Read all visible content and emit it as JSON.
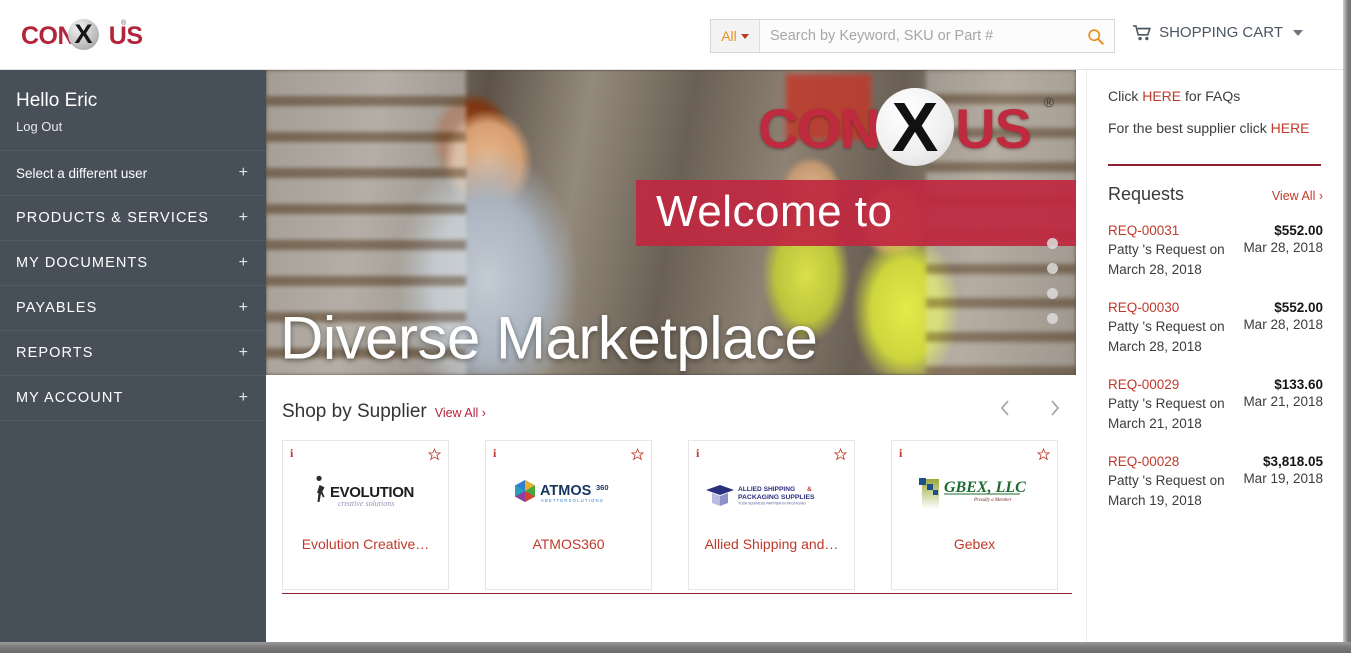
{
  "header": {
    "logo_text_left": "CONN",
    "logo_x": "X",
    "logo_text_right": "US",
    "logo_reg": "®",
    "search": {
      "scope_label": "All",
      "placeholder": "Search by Keyword, SKU or Part #",
      "value": "",
      "search_icon": "search-icon"
    },
    "cart_label": "SHOPPING CART",
    "cart_icon": "shopping-cart-icon"
  },
  "sidebar": {
    "greeting": "Hello Eric",
    "logout": "Log Out",
    "items": [
      {
        "label": "Select a different user",
        "expander": "+",
        "caps": false
      },
      {
        "label": "PRODUCTS & SERVICES",
        "expander": "+",
        "caps": true
      },
      {
        "label": "MY DOCUMENTS",
        "expander": "+",
        "caps": true
      },
      {
        "label": "PAYABLES",
        "expander": "+",
        "caps": true
      },
      {
        "label": "REPORTS",
        "expander": "+",
        "caps": true
      },
      {
        "label": "MY ACCOUNT",
        "expander": "+",
        "caps": true
      }
    ]
  },
  "hero": {
    "brand_left": "CONN",
    "brand_x": "X",
    "brand_right": "US",
    "brand_reg": "®",
    "welcome": "Welcome to",
    "headline": "Diverse Marketplace",
    "dots": 4,
    "band_color": "#c0283f"
  },
  "shop": {
    "title": "Shop by Supplier",
    "view_all": "View All ›",
    "prev_icon": "chevron-left-icon",
    "next_icon": "chevron-right-icon",
    "cards": [
      {
        "name": "Evolution Creative…",
        "logo_label": "EVOLUTION",
        "logo_sub": "creative solutions",
        "info_icon": "info-icon",
        "star_icon": "star-outline-icon"
      },
      {
        "name": "ATMOS360",
        "logo_label": "ATMOS",
        "logo_sub": "360",
        "info_icon": "info-icon",
        "star_icon": "star-outline-icon"
      },
      {
        "name": "Allied Shipping and…",
        "logo_label": "ALLIED SHIPPING &",
        "logo_sub": "PACKAGING SUPPLIES",
        "info_icon": "info-icon",
        "star_icon": "star-outline-icon"
      },
      {
        "name": "Gebex",
        "logo_label": "GBEX, LLC",
        "logo_sub": "",
        "info_icon": "info-icon",
        "star_icon": "star-outline-icon"
      }
    ]
  },
  "panel": {
    "faq_pre": "Click ",
    "faq_link": "HERE",
    "faq_post": " for FAQs",
    "supplier_pre": "For the best supplier click ",
    "supplier_link": "HERE",
    "requests_title": "Requests",
    "requests_view_all": "View All ›",
    "requests": [
      {
        "id": "REQ-00031",
        "amount": "$552.00",
        "description": "Patty 's Request on March 28, 2018",
        "date": "Mar 28, 2018"
      },
      {
        "id": "REQ-00030",
        "amount": "$552.00",
        "description": "Patty 's Request on March 28, 2018",
        "date": "Mar 28, 2018"
      },
      {
        "id": "REQ-00029",
        "amount": "$133.60",
        "description": "Patty 's Request on March 21, 2018",
        "date": "Mar 21, 2018"
      },
      {
        "id": "REQ-00028",
        "amount": "$3,818.05",
        "description": "Patty 's Request on March 19, 2018",
        "date": "Mar 19, 2018"
      }
    ]
  },
  "colors": {
    "brand_red": "#c0392b",
    "deep_red": "#8f1f32",
    "sidebar_bg": "#474f58",
    "accent_orange": "#e8921f"
  }
}
